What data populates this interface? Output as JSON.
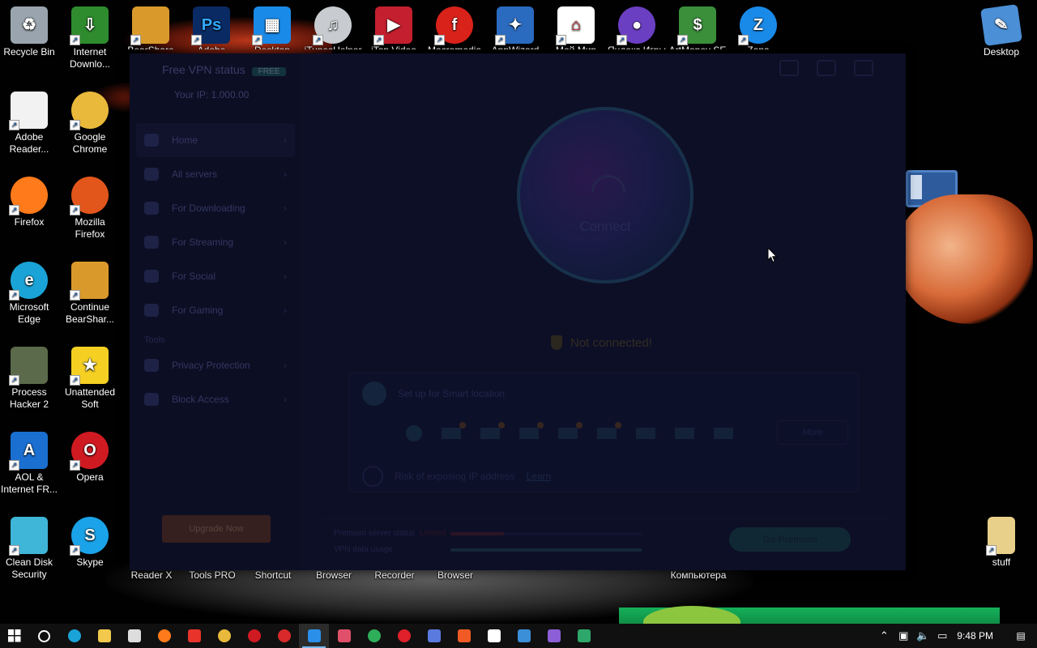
{
  "desktop": {
    "icons_left": [
      {
        "label": "Recycle Bin",
        "icon": "recycle-bin-icon",
        "color": "#9aa4ae",
        "glyph": "♻"
      },
      {
        "label": "Internet Downlo...",
        "icon": "idm-icon",
        "color": "#2e8b2e",
        "glyph": "⇩"
      },
      {
        "label": "Adobe Reader...",
        "icon": "pdf-document-icon",
        "color": "#f2f2f2",
        "glyph": ""
      },
      {
        "label": "Google Chrome",
        "icon": "chrome-icon",
        "color": "#e8b93b",
        "glyph": ""
      },
      {
        "label": "Firefox",
        "icon": "firefox-icon",
        "color": "#ff7a1a",
        "glyph": ""
      },
      {
        "label": "Mozilla Firefox",
        "icon": "firefox-icon",
        "color": "#e2561b",
        "glyph": ""
      },
      {
        "label": "Microsoft Edge",
        "icon": "edge-icon",
        "color": "#1aa3d6",
        "glyph": "e"
      },
      {
        "label": "Continue BearShar...",
        "icon": "bearshare-icon",
        "color": "#d99a2b",
        "glyph": ""
      },
      {
        "label": "Process Hacker 2",
        "icon": "process-hacker-icon",
        "color": "#5a6a4a",
        "glyph": ""
      },
      {
        "label": "Unattended Soft",
        "icon": "star-icon",
        "color": "#f5d022",
        "glyph": "★"
      },
      {
        "label": "AOL & Internet FR...",
        "icon": "aol-icon",
        "color": "#1a6fd0",
        "glyph": "A"
      },
      {
        "label": "Opera",
        "icon": "opera-icon",
        "color": "#d01a22",
        "glyph": "O"
      },
      {
        "label": "Clean Disk Security",
        "icon": "clean-disk-icon",
        "color": "#3fb5d8",
        "glyph": ""
      },
      {
        "label": "Skype",
        "icon": "skype-icon",
        "color": "#1aa3e8",
        "glyph": "S"
      }
    ],
    "icons_top": [
      {
        "label": "BearShare",
        "icon": "bearshare-icon",
        "color": "#d99a2b",
        "glyph": ""
      },
      {
        "label": "Adobe",
        "icon": "photoshop-icon",
        "color": "#0a2a63",
        "glyph": "Ps"
      },
      {
        "label": "Desktop",
        "icon": "windows-tiles-icon",
        "color": "#1a8ae8",
        "glyph": "▦"
      },
      {
        "label": "iTunesHelper",
        "icon": "itunes-icon",
        "color": "#c8ccd0",
        "glyph": "♫"
      },
      {
        "label": "iTop Video",
        "icon": "video-editor-icon",
        "color": "#c41f2f",
        "glyph": "▶"
      },
      {
        "label": "Macromedia",
        "icon": "flash-icon",
        "color": "#d8221a",
        "glyph": "f"
      },
      {
        "label": "AppWizard",
        "icon": "app-wizard-icon",
        "color": "#2a6bc0",
        "glyph": "✦"
      },
      {
        "label": "Мой Мир",
        "icon": "house-icon",
        "color": "#ffffff",
        "glyph": "⌂"
      },
      {
        "label": "Яндекс Игры",
        "icon": "gamepad-icon",
        "color": "#6b3fc2",
        "glyph": "●"
      },
      {
        "label": "ArtMoney SE",
        "icon": "money-icon",
        "color": "#3b8f3b",
        "glyph": "$"
      },
      {
        "label": "Zona",
        "icon": "zona-icon",
        "color": "#1a8ae8",
        "glyph": "Z"
      }
    ],
    "bottom_labels": [
      "Reader X",
      "Tools PRO",
      "Shortcut",
      "Browser",
      "Recorder",
      "Browser",
      "Компьютера"
    ],
    "icon_desktop_right": {
      "label": "Desktop",
      "icon": "desktop-folder-icon",
      "color": "#4b8fd6"
    },
    "icon_stuff": {
      "label": "stuff",
      "icon": "folder-icon",
      "color": "#e8d08a"
    }
  },
  "vpn": {
    "brand": "Free VPN status",
    "badge": "FREE",
    "ip": "Your IP: 1.000.00",
    "nav": [
      {
        "label": "Home",
        "icon": "home-icon"
      },
      {
        "label": "All servers",
        "icon": "globe-icon"
      },
      {
        "label": "For Downloading",
        "icon": "download-icon"
      },
      {
        "label": "For Streaming",
        "icon": "tv-icon"
      },
      {
        "label": "For Social",
        "icon": "social-icon"
      },
      {
        "label": "For Gaming",
        "icon": "gamepad-icon"
      }
    ],
    "section_label": "Tools",
    "tools": [
      {
        "label": "Privacy Protection",
        "icon": "privacy-icon"
      },
      {
        "label": "Block Access",
        "icon": "block-icon"
      }
    ],
    "upgrade": "Upgrade Now",
    "connect_label": "Connect",
    "status": "Not connected!",
    "card_title": "Set up for Smart location",
    "more": "More",
    "card_footer": "Risk of exposing IP address",
    "card_link": "Learn",
    "footer_line1": "Premium server status",
    "footer_line1_value": "Limited",
    "footer_line2": "VPN data usage",
    "footer_button": "Go Premium",
    "colors": {
      "accent": "#2b6a89",
      "status": "#6c5b1a",
      "upgrade": "#7a3a16"
    }
  },
  "taskbar": {
    "apps": [
      {
        "name": "search",
        "icon": "search-icon",
        "color": "#ffffff"
      },
      {
        "name": "edge",
        "icon": "edge-icon",
        "color": "#1aa3d6"
      },
      {
        "name": "file-explorer",
        "icon": "folder-icon",
        "color": "#f2c94c"
      },
      {
        "name": "store",
        "icon": "store-icon",
        "color": "#dddddd"
      },
      {
        "name": "firefox",
        "icon": "firefox-icon",
        "color": "#ff7a1a"
      },
      {
        "name": "yandex",
        "icon": "yandex-icon",
        "color": "#e8332b"
      },
      {
        "name": "chrome",
        "icon": "chrome-icon",
        "color": "#e8b93b"
      },
      {
        "name": "opera",
        "icon": "opera-icon",
        "color": "#d01a22"
      },
      {
        "name": "app-red",
        "icon": "target-icon",
        "color": "#d82a2a"
      },
      {
        "name": "vpn-shield",
        "icon": "shield-icon",
        "color": "#2a8fe8"
      },
      {
        "name": "recorder",
        "icon": "camera-icon",
        "color": "#e0506a"
      },
      {
        "name": "browser-g",
        "icon": "globe-icon",
        "color": "#2eae58"
      },
      {
        "name": "opera-gx",
        "icon": "opera-icon",
        "color": "#e0202a"
      },
      {
        "name": "wizard",
        "icon": "app-wizard-icon",
        "color": "#5a7adf"
      },
      {
        "name": "brave",
        "icon": "brave-icon",
        "color": "#f05a24"
      },
      {
        "name": "moy-mir",
        "icon": "house-icon",
        "color": "#ffffff"
      },
      {
        "name": "tool-blue",
        "icon": "tool-icon",
        "color": "#3b8ed8"
      },
      {
        "name": "visual-studio",
        "icon": "vs-icon",
        "color": "#8c5fd6"
      },
      {
        "name": "shield-green",
        "icon": "shield-icon",
        "color": "#2ea86a"
      }
    ],
    "clock": "9:48 PM"
  }
}
